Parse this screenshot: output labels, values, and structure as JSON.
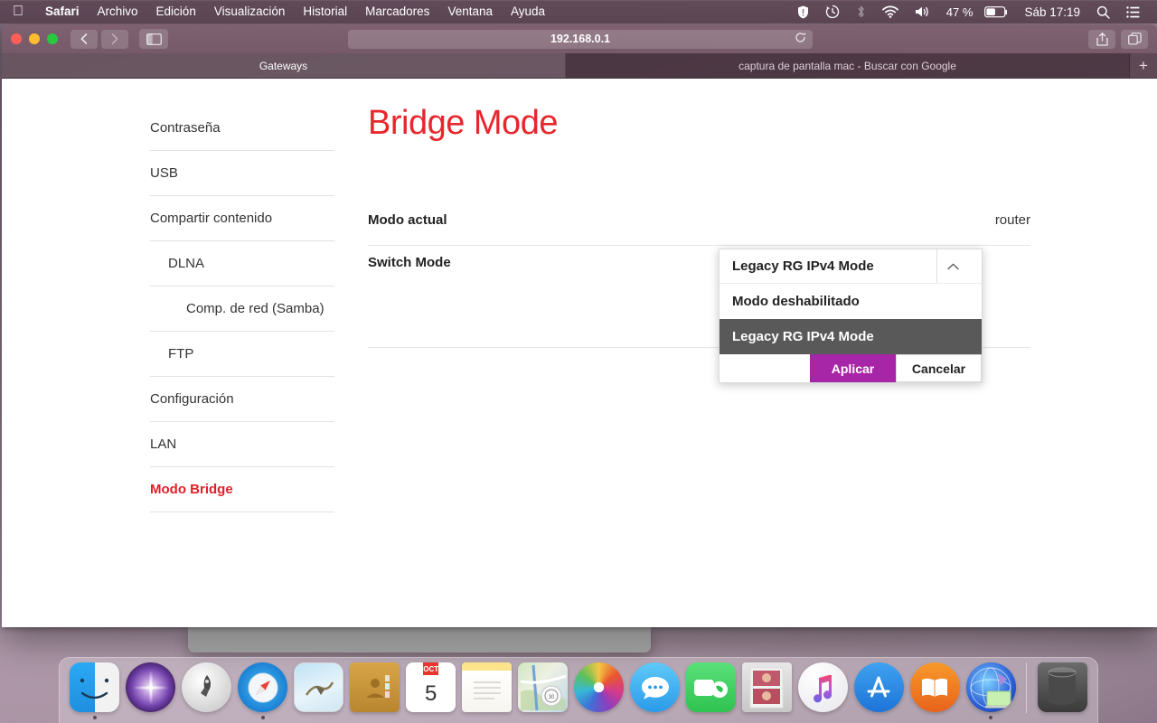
{
  "menubar": {
    "apple_icon": "apple-logo",
    "items": [
      {
        "label": "Safari",
        "bold": true
      },
      {
        "label": "Archivo",
        "bold": false
      },
      {
        "label": "Edición",
        "bold": false
      },
      {
        "label": "Visualización",
        "bold": false
      },
      {
        "label": "Historial",
        "bold": false
      },
      {
        "label": "Marcadores",
        "bold": false
      },
      {
        "label": "Ventana",
        "bold": false
      },
      {
        "label": "Ayuda",
        "bold": false
      }
    ],
    "status": {
      "shield_icon": "shield-icon",
      "timemachine_icon": "time-machine-icon",
      "bluetooth_icon": "bluetooth-icon",
      "wifi_icon": "wifi-icon",
      "volume_icon": "volume-icon",
      "battery_percent": "47 %",
      "battery_icon": "battery-icon",
      "clock": "Sáb 17:19",
      "search_icon": "spotlight-search-icon",
      "controlcenter_icon": "notification-center-icon"
    }
  },
  "browser": {
    "traffic_lights": {
      "close": "close",
      "minimize": "minimize",
      "zoom": "zoom"
    },
    "back_icon": "chevron-left-icon",
    "forward_icon": "chevron-right-icon",
    "sidebar_icon": "sidebar-toggle-icon",
    "url": "192.168.0.1",
    "reload_icon": "reload-icon",
    "share_icon": "share-icon",
    "tabs_overview_icon": "tab-overview-icon",
    "new_tab_label": "+",
    "tabs": [
      {
        "title": "Gateways",
        "active": true
      },
      {
        "title": "captura de pantalla mac - Buscar con Google",
        "active": false
      }
    ]
  },
  "sidebar": {
    "items": [
      {
        "label": "Contraseña",
        "level": 0,
        "active": false
      },
      {
        "label": "USB",
        "level": 0,
        "active": false
      },
      {
        "label": "Compartir contenido",
        "level": 0,
        "active": false
      },
      {
        "label": "DLNA",
        "level": 1,
        "active": false
      },
      {
        "label": "Comp. de red (Samba)",
        "level": 2,
        "active": false
      },
      {
        "label": "FTP",
        "level": 1,
        "active": false
      },
      {
        "label": "Configuración",
        "level": 0,
        "active": false
      },
      {
        "label": "LAN",
        "level": 0,
        "active": false
      },
      {
        "label": "Modo Bridge",
        "level": 0,
        "active": true
      }
    ]
  },
  "main": {
    "title": "Bridge Mode",
    "title_color": "#e8262d",
    "rows": [
      {
        "label": "Modo actual",
        "value": "router"
      },
      {
        "label": "Switch Mode",
        "value": ""
      }
    ]
  },
  "dropdown": {
    "selected": "Legacy RG IPv4 Mode",
    "caret_icon": "chevron-up-icon",
    "options": [
      {
        "label": "Modo deshabilitado",
        "highlighted": false
      },
      {
        "label": "Legacy RG IPv4 Mode",
        "highlighted": true
      }
    ],
    "apply_label": "Aplicar",
    "cancel_label": "Cancelar",
    "apply_color": "#a725a7"
  },
  "dock": {
    "items": [
      {
        "name": "finder",
        "running": true
      },
      {
        "name": "siri",
        "running": false
      },
      {
        "name": "launchpad",
        "running": false
      },
      {
        "name": "safari",
        "running": true
      },
      {
        "name": "mail",
        "running": false
      },
      {
        "name": "contacts",
        "running": false
      },
      {
        "name": "calendar",
        "running": false,
        "month": "OCT",
        "day": "5"
      },
      {
        "name": "notes",
        "running": false
      },
      {
        "name": "maps",
        "running": false
      },
      {
        "name": "photos",
        "running": false
      },
      {
        "name": "messages",
        "running": false
      },
      {
        "name": "facetime",
        "running": false
      },
      {
        "name": "photo-booth",
        "running": false
      },
      {
        "name": "itunes",
        "running": false
      },
      {
        "name": "app-store",
        "running": false
      },
      {
        "name": "ibooks",
        "running": false
      },
      {
        "name": "screen-sharing",
        "running": true
      }
    ],
    "trash": {
      "name": "trash"
    }
  }
}
